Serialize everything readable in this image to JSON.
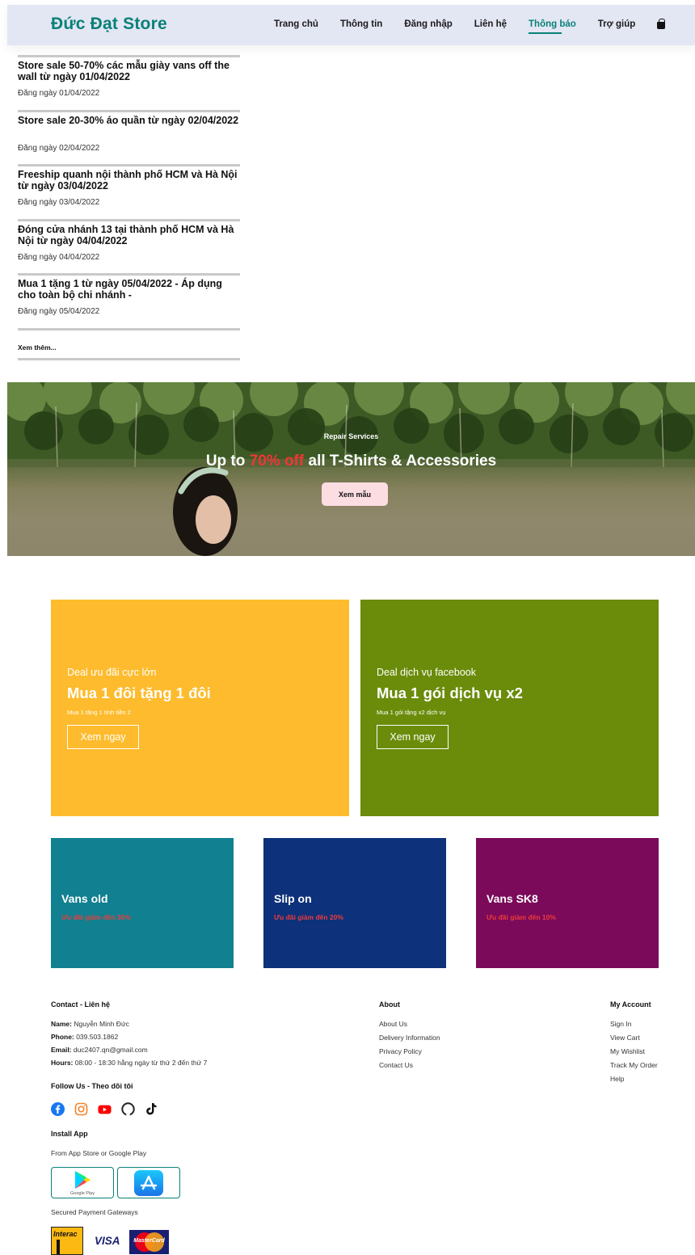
{
  "header": {
    "logo": "Đức Đạt Store",
    "nav": [
      "Trang chủ",
      "Thông tin",
      "Đăng nhập",
      "Liên hệ",
      "Thông báo",
      "Trợ giúp"
    ],
    "active_nav": "Thông báo"
  },
  "notices": [
    {
      "title": "Store sale 50-70% các mẫu giày vans off the wall từ ngày 01/04/2022",
      "date": "Đăng ngày 01/04/2022"
    },
    {
      "title": "Store sale 20-30% áo quần từ ngày 02/04/2022",
      "date": "Đăng ngày 02/04/2022"
    },
    {
      "title": "Freeship quanh nội thành phố HCM và Hà Nội từ ngày 03/04/2022",
      "date": "Đăng ngày 03/04/2022"
    },
    {
      "title": "Đóng cửa nhánh 13 tại thành phố HCM và Hà Nội từ ngày 04/04/2022",
      "date": "Đăng ngày 04/04/2022"
    },
    {
      "title": "Mua 1 tặng 1 từ ngày 05/04/2022 - Áp dụng cho toàn bộ chi nhánh -",
      "date": "Đăng ngày 05/04/2022"
    }
  ],
  "more_link": "Xem thêm...",
  "banner": {
    "subtitle": "Repair Services",
    "title_pre": "Up to ",
    "title_highlight": "70% off",
    "title_post": " all T-Shirts & Accessories",
    "button": "Xem mẫu"
  },
  "deals": [
    {
      "small": "Deal ưu đãi cực lớn",
      "big": "Mua 1 đôi tặng 1 đôi",
      "tiny": "Mua 1 tặng 1 tính tiền 2",
      "button": "Xem ngay",
      "color": "#fdbb2d"
    },
    {
      "small": "Deal dịch vụ facebook",
      "big": "Mua 1 gói dịch vụ x2",
      "tiny": "Mua 1 gói tặng x2 dịch vụ",
      "button": "Xem ngay",
      "color": "#6a8c0a"
    }
  ],
  "categories": [
    {
      "title": "Vans old",
      "sub": "Ưu đãi giảm đến 30%",
      "color": "#118090"
    },
    {
      "title": "Slip on",
      "sub": "Ưu đãi giảm đến 20%",
      "color": "#0d317a"
    },
    {
      "title": "Vans SK8",
      "sub": "Ưu đãi giảm đến 10%",
      "color": "#7b0a5a"
    }
  ],
  "footer": {
    "contact_head": "Contact - Liên hệ",
    "name_label": "Name:",
    "name": "Nguyễn Minh Đức",
    "phone_label": "Phone:",
    "phone": "039.503.1862",
    "email_label": "Email:",
    "email": "duc2407.qn@gmail.com",
    "hours_label": "Hours:",
    "hours": "08:00 - 18:30 hằng ngày từ thứ 2 đến thứ 7",
    "follow_head": "Follow Us - Theo dõi tôi",
    "social_icons": [
      "facebook-icon",
      "instagram-icon",
      "youtube-icon",
      "github-icon",
      "tiktok-icon"
    ],
    "install_head": "Install App",
    "install_text": "From App Store or Google Play",
    "google_play_label": "Google Play",
    "payment_text": "Secured Payment Gateways",
    "payment_labels": [
      "Interac",
      "VISA",
      "MasterCard"
    ],
    "about_head": "About",
    "about_links": [
      "About Us",
      "Delivery Information",
      "Privacy Policy",
      "Contact Us"
    ],
    "account_head": "My Account",
    "account_links": [
      "Sign In",
      "View Cart",
      "My Wishlist",
      "Track My Order",
      "Help"
    ]
  }
}
